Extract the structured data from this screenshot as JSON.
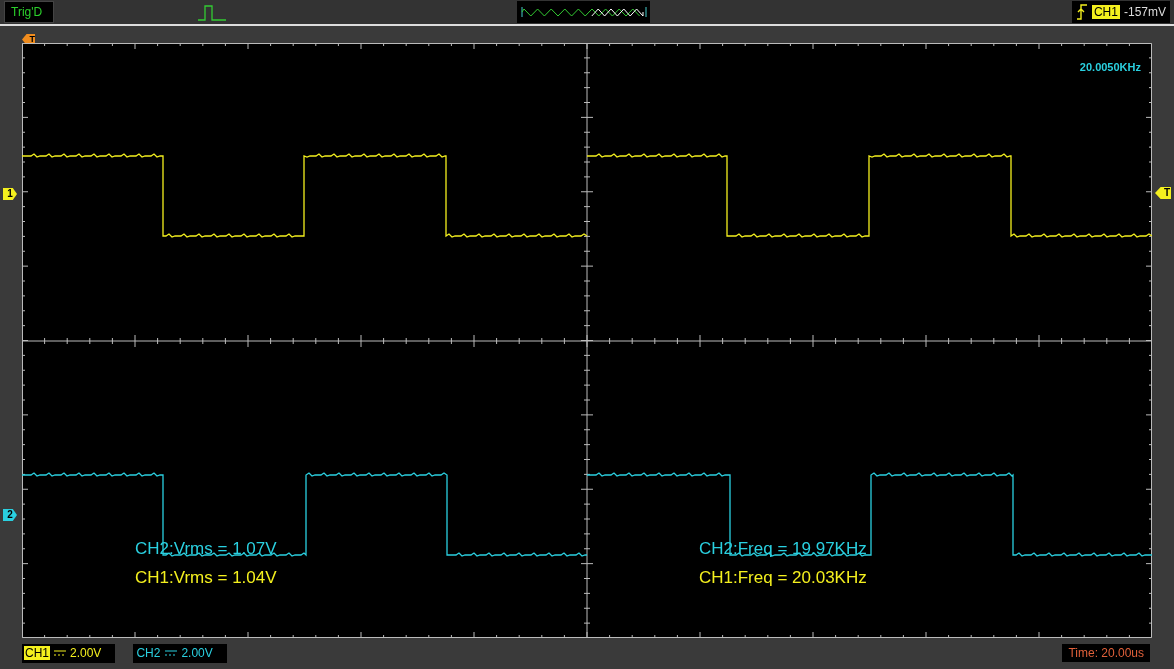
{
  "top_bar": {
    "trigger_status": "Trig'D",
    "trigger_source": "CH1",
    "trigger_level": "-157mV"
  },
  "markers": {
    "trigger_position": "T",
    "trigger_level": "T",
    "channels": [
      {
        "label": "1",
        "color": "#f4f01e"
      },
      {
        "label": "2",
        "color": "#2ad0e0"
      }
    ]
  },
  "plot": {
    "frequency": "20.0050KHz",
    "measurements": [
      {
        "text": "CH2:Vrms = 1.07V",
        "color": "#2ad0e0"
      },
      {
        "text": "CH1:Vrms = 1.04V",
        "color": "#f4f01e"
      },
      {
        "text": "CH2:Freq = 19.97KHz",
        "color": "#2ad0e0"
      },
      {
        "text": "CH1:Freq = 20.03KHz",
        "color": "#f4f01e"
      }
    ]
  },
  "bottom_bar": {
    "channels": [
      {
        "name": "CH1",
        "scale": "2.00V",
        "color": "#f4f01e"
      },
      {
        "name": "CH2",
        "scale": "2.00V",
        "color": "#2ad0e0"
      }
    ],
    "time": "Time: 20.00us"
  }
}
